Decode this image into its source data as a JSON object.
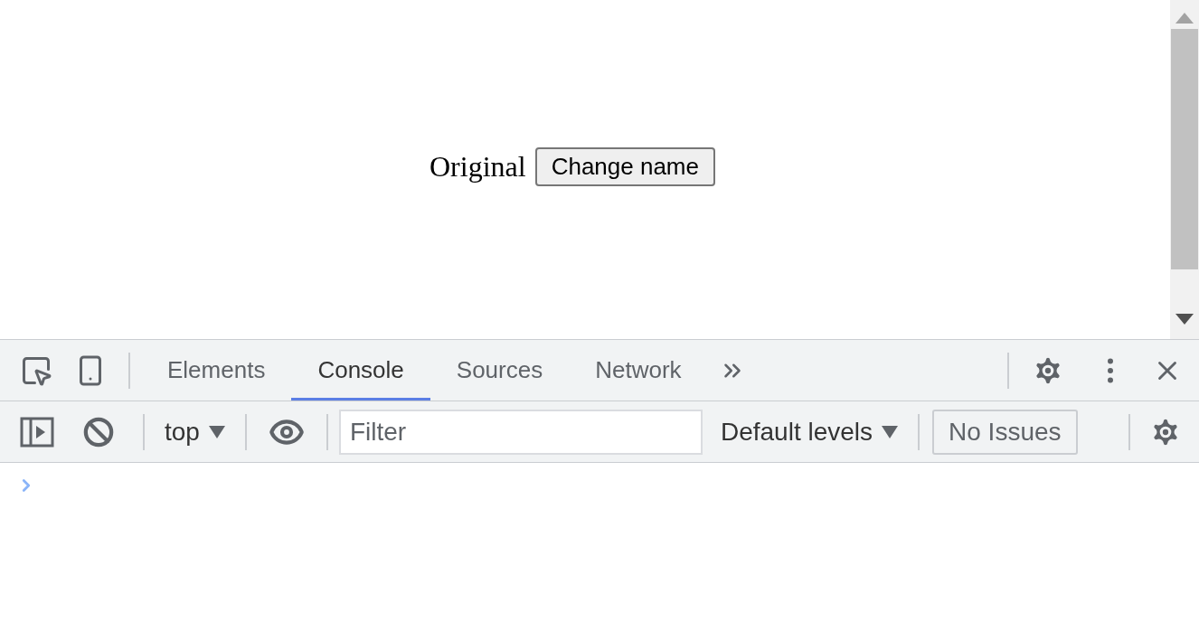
{
  "page": {
    "text": "Original",
    "button": "Change name"
  },
  "devtools": {
    "tabs": [
      {
        "label": "Elements",
        "selected": false
      },
      {
        "label": "Console",
        "selected": true
      },
      {
        "label": "Sources",
        "selected": false
      },
      {
        "label": "Network",
        "selected": false
      }
    ]
  },
  "console_toolbar": {
    "context": "top",
    "filter": {
      "placeholder": "Filter"
    },
    "levels": "Default levels",
    "issues": "No Issues"
  }
}
